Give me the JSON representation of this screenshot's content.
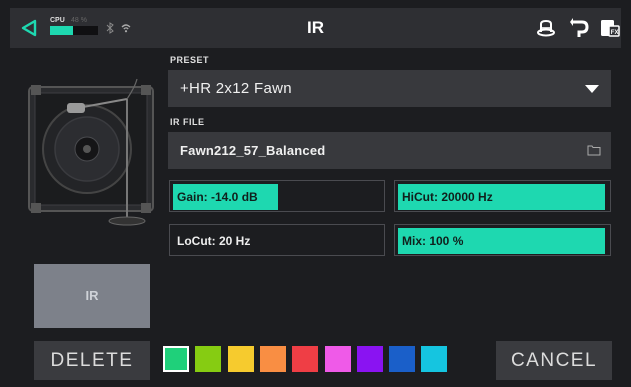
{
  "topbar": {
    "title": "IR",
    "cpu_label": "CPU",
    "cpu_percent_text": "48 %",
    "cpu_fraction": 0.48,
    "icons": [
      "back-icon",
      "bluetooth-icon",
      "wifi-icon",
      "hat-icon",
      "reload-icon",
      "fx-icon"
    ]
  },
  "preset": {
    "label": "PRESET",
    "value": "+HR 2x12 Fawn"
  },
  "ir_file": {
    "label": "IR FILE",
    "value": "Fawn212_57_Balanced"
  },
  "params": {
    "gain": {
      "text": "Gain: -14.0 dB",
      "fraction": 0.5
    },
    "hicut": {
      "text": "HiCut: 20000 Hz",
      "fraction": 1.0
    },
    "locut": {
      "text": "LoCut: 20 Hz",
      "fraction": 0.0
    },
    "mix": {
      "text": "Mix: 100 %",
      "fraction": 1.0
    }
  },
  "ir_block_label": "IR",
  "buttons": {
    "delete": "DELETE",
    "cancel": "CANCEL"
  },
  "colors": {
    "accent": "#1ed8b0",
    "swatches": [
      "#1fd07a",
      "#86cc12",
      "#f6cb2e",
      "#f98e43",
      "#ef3e45",
      "#ef5ae8",
      "#8a13f2",
      "#1a5fc9",
      "#15c5e0"
    ],
    "selected_swatch": 0
  }
}
